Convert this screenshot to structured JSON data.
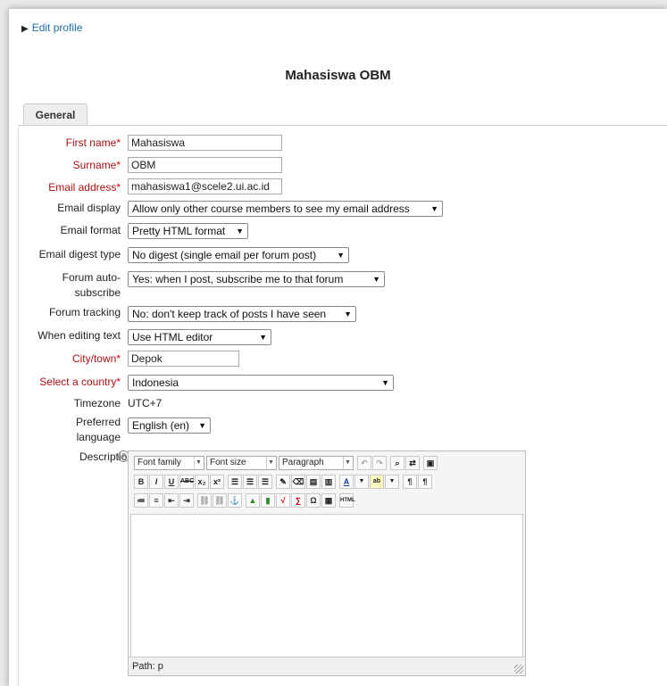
{
  "breadcrumb": {
    "label": "Edit profile"
  },
  "page_title": "Mahasiswa OBM",
  "tab": {
    "label": "General"
  },
  "fields": {
    "first_name": {
      "label": "First name",
      "value": "Mahasiswa"
    },
    "surname": {
      "label": "Surname",
      "value": "OBM"
    },
    "email": {
      "label": "Email address",
      "value": "mahasiswa1@scele2.ui.ac.id"
    },
    "email_display": {
      "label": "Email display",
      "value": "Allow only other course members to see my email address"
    },
    "email_format": {
      "label": "Email format",
      "value": "Pretty HTML format"
    },
    "email_digest": {
      "label": "Email digest type",
      "value": "No digest (single email per forum post)"
    },
    "forum_auto_1": {
      "label": "Forum auto-"
    },
    "forum_auto_2": {
      "label": "subscribe"
    },
    "forum_auto": {
      "value": "Yes: when I post, subscribe me to that forum"
    },
    "forum_tracking": {
      "label": "Forum tracking",
      "value": "No: don't keep track of posts I have seen"
    },
    "editing_text": {
      "label": "When editing text",
      "value": "Use HTML editor"
    },
    "city": {
      "label": "City/town",
      "value": "Depok"
    },
    "country": {
      "label": "Select a country",
      "value": "Indonesia"
    },
    "timezone": {
      "label": "Timezone",
      "value": "UTC+7"
    },
    "language_1": {
      "label": "Preferred"
    },
    "language_2": {
      "label": "language"
    },
    "language": {
      "value": "English (en)"
    },
    "description": {
      "label": "Description"
    }
  },
  "required_mark": "*",
  "editor": {
    "font_family": "Font family",
    "font_size": "Font size",
    "format": "Paragraph",
    "path_label": "Path: p"
  }
}
